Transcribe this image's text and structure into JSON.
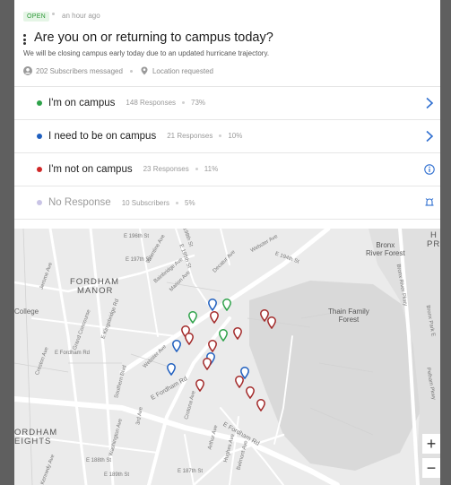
{
  "header": {
    "status_badge": "OPEN",
    "time": "an hour ago",
    "title": "Are you on or returning to campus today?",
    "subtitle": "We will be closing campus early today due to an updated hurricane trajectory.",
    "subscribers_text": "202 Subscribers messaged",
    "location_text": "Location requested"
  },
  "responses": [
    {
      "label": "I'm on campus",
      "count": "148 Responses",
      "percent": "73%",
      "color": "#2ea24a",
      "action_icon": "chevron-right-icon"
    },
    {
      "label": "I need to be on campus",
      "count": "21 Responses",
      "percent": "10%",
      "color": "#1f5fbf",
      "action_icon": "chevron-right-icon"
    },
    {
      "label": "I'm not on campus",
      "count": "23 Responses",
      "percent": "11%",
      "color": "#d02727",
      "action_icon": "info-icon"
    },
    {
      "label": "No Response",
      "count": "10 Subscribers",
      "percent": "5%",
      "color": "#c9c4e6",
      "action_icon": "alarm-icon"
    }
  ],
  "map": {
    "areas": [
      "FORDHAM",
      "MANOR",
      "ORDHAM",
      "EIGHTS"
    ],
    "park": [
      "Thain Family",
      "Forest"
    ],
    "river": [
      "Bronx",
      "River Forest"
    ],
    "edge_letters": [
      "H",
      "PR"
    ],
    "places": [
      "College"
    ],
    "streets": [
      "E 196th St",
      "E 198th St",
      "E 197th St",
      "Valentine Ave",
      "E 195th St",
      "Webster Ave",
      "Decatur Ave",
      "Bainbridge Ave",
      "Marion Ave",
      "E 194th St",
      "Jerome Ave",
      "Grand Concourse",
      "E Kingsbridge Rd",
      "Creston Ave",
      "E Fordham Rd",
      "Webster Ave",
      "E Fordham Rd",
      "Bronx River Pkwy",
      "Bronx Park E",
      "Pelham Pkwy",
      "Southern Blvd",
      "3rd Ave",
      "E Fordham Rd",
      "Crotona Ave",
      "Arthur Ave",
      "Hughes Ave",
      "Belmont Ave",
      "E 187th St",
      "E 188th St",
      "Washington Ave",
      "E 189th St",
      "Kennedy Ave"
    ],
    "zoom_in": "+",
    "zoom_out": "−"
  }
}
